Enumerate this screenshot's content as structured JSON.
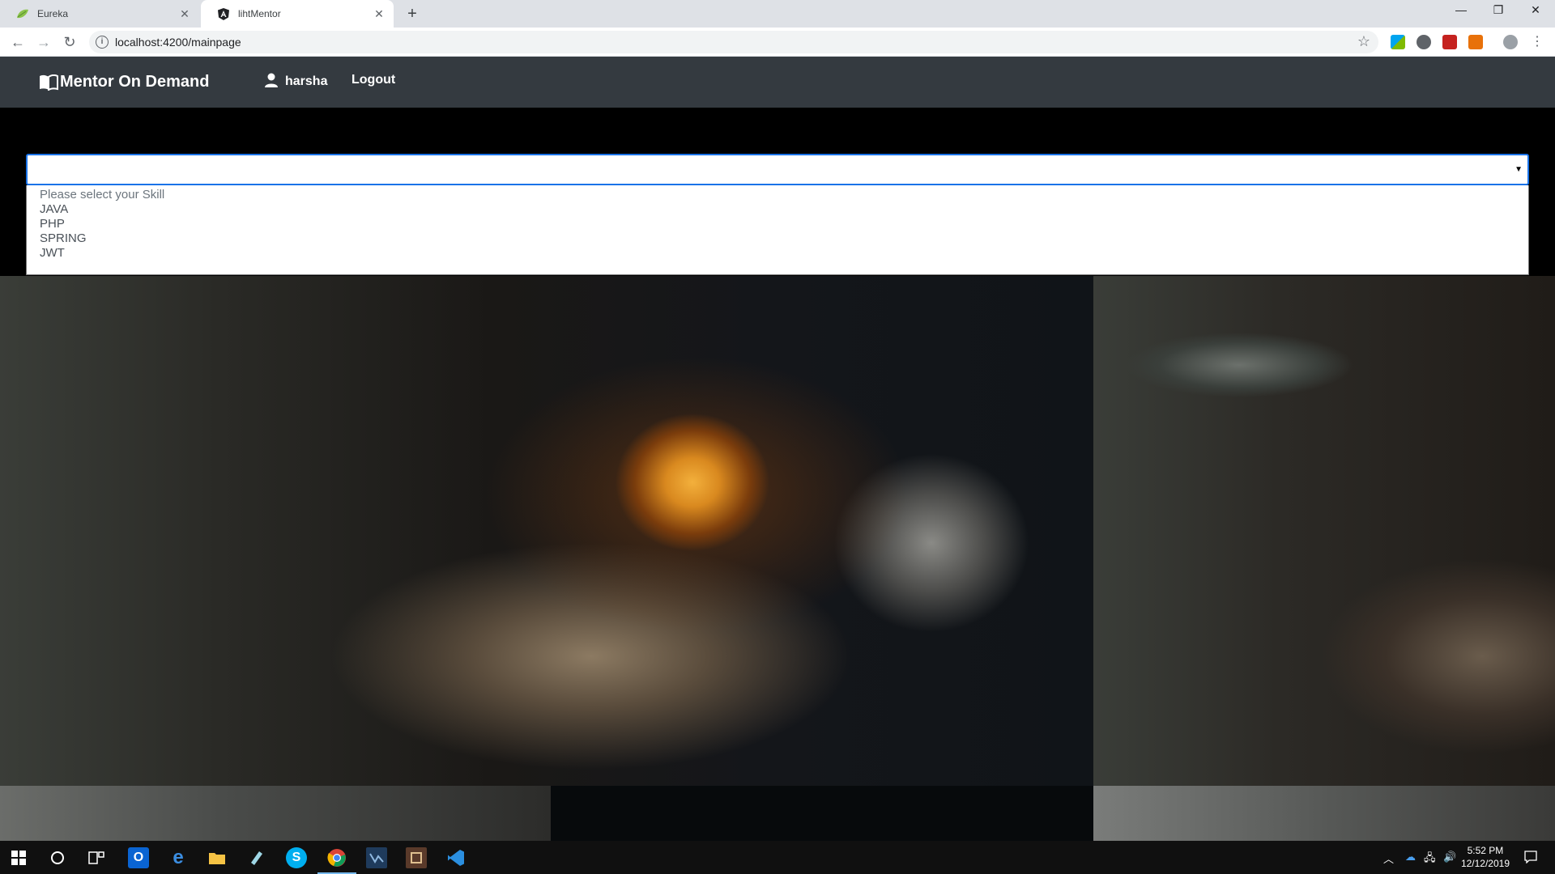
{
  "browser": {
    "tabs": [
      {
        "title": "Eureka",
        "icon": "leaf-icon",
        "active": false
      },
      {
        "title": "lihtMentor",
        "icon": "angular-icon",
        "active": true
      }
    ],
    "url": "localhost:4200/mainpage"
  },
  "navbar": {
    "brand": "Mentor On Demand",
    "user": "harsha",
    "logout": "Logout"
  },
  "skill_select": {
    "selected": "",
    "options": [
      "Please select your Skill",
      "JAVA",
      "PHP",
      "SPRING",
      "JWT"
    ]
  },
  "taskbar": {
    "time": "5:52 PM",
    "date": "12/12/2019"
  },
  "colors": {
    "navbar": "#343a40",
    "select_border": "#1a73e8",
    "taskbar": "#101010"
  }
}
